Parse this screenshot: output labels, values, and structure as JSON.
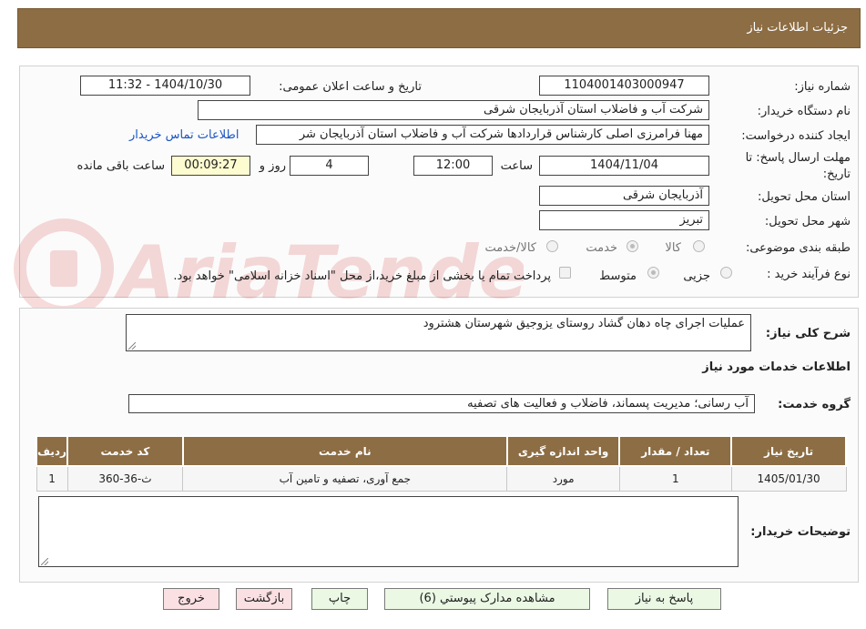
{
  "header": {
    "title": "جزئیات اطلاعات نیاز"
  },
  "watermark": {
    "text": "AriaTender.neT"
  },
  "need": {
    "number_label": "شماره نیاز:",
    "number": "1104001403000947",
    "announce_label": "تاریخ و ساعت اعلان عمومی:",
    "announce_value": "1404/10/30 - 11:32",
    "buyer_label": "نام دستگاه خریدار:",
    "buyer": "شرکت آب و فاضلاب استان آذربایجان شرقی",
    "creator_label": "ایجاد کننده درخواست:",
    "creator": "مهنا فرامرزی اصلی کارشناس قراردادها شرکت آب و فاضلاب استان آذربایجان شر",
    "contact_link": "اطلاعات تماس خریدار",
    "deadline_label_1": "مهلت ارسال پاسخ: تا",
    "deadline_label_2": "تاریخ:",
    "deadline_date": "1404/11/04",
    "time_label": "ساعت",
    "deadline_time": "12:00",
    "days_value": "4",
    "days_label": "روز و",
    "remaining_time": "00:09:27",
    "remaining_label": "ساعت باقی مانده",
    "province_label": "استان محل تحویل:",
    "province": "آذربایجان شرقی",
    "city_label": "شهر محل تحویل:",
    "city": "تبریز",
    "category_label": "طبقه بندی موضوعی:",
    "category_options": [
      "کالا",
      "خدمت",
      "کالا/خدمت"
    ],
    "process_label": "نوع فرآیند خرید :",
    "process_options": [
      "جزیی",
      "متوسط"
    ],
    "treasury_note": "پرداخت تمام یا بخشی از مبلغ خرید،از محل \"اسناد خزانه اسلامی\" خواهد بود."
  },
  "description": {
    "label": "شرح کلی نیاز:",
    "text": "عملیات اجرای چاه دهان گشاد روستای یزوجیق شهرستان هشترود"
  },
  "services": {
    "section_title": "اطلاعات خدمات مورد نیاز",
    "group_label": "گروه خدمت:",
    "group_value": "آب رسانی؛ مدیریت پسماند، فاضلاب و فعالیت های تصفیه",
    "columns": [
      "ردیف",
      "کد خدمت",
      "نام خدمت",
      "واحد اندازه گیری",
      "تعداد / مقدار",
      "تاریخ نیاز"
    ],
    "rows": [
      [
        "1",
        "ث-36-360",
        "جمع آوری، تصفیه و تامین آب",
        "مورد",
        "1",
        "1405/01/30"
      ]
    ]
  },
  "buyer_notes": {
    "label": "توضیحات خریدار:",
    "text": ""
  },
  "buttons": {
    "reply": "پاسخ به نیاز",
    "attachments": "مشاهده مدارک پیوستي (6)",
    "print": "چاپ",
    "back": "بازگشت",
    "exit": "خروج"
  },
  "colors": {
    "header_bg": "#8d6d43",
    "button_green": "#eaf8e4",
    "button_pink": "#fbe0e3",
    "link": "#1a55c4"
  }
}
